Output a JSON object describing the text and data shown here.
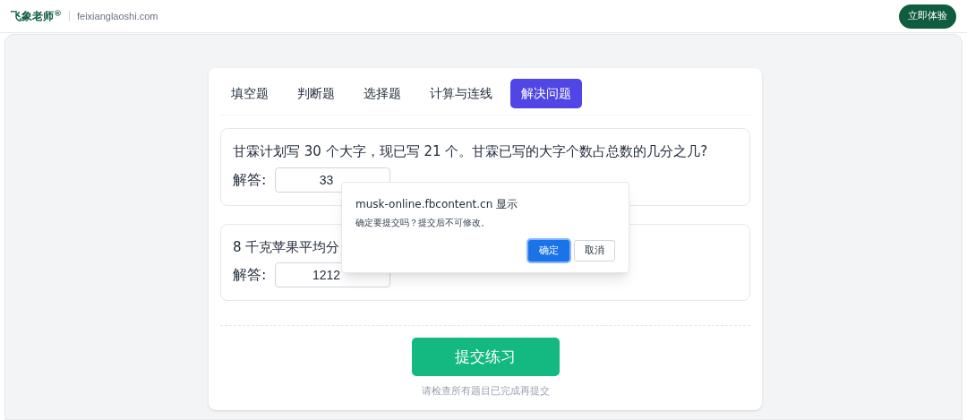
{
  "header": {
    "logo": "飞象老师$^{®}$",
    "domain": "feixianglaoshi.com",
    "cta": "立即体验"
  },
  "tabs": [
    {
      "label": "填空题",
      "selected": false
    },
    {
      "label": "判断题",
      "selected": false
    },
    {
      "label": "选择题",
      "selected": false
    },
    {
      "label": "计算与连线",
      "selected": false
    },
    {
      "label": "解决问题",
      "selected": true
    }
  ],
  "questions": [
    {
      "text": "甘霖计划写 30 个大字，现已写 21 个。甘霖已写的大字个数占总数的几分之几?",
      "answer_label": "解答:",
      "value": "33"
    },
    {
      "text": "8 千克苹果平均分",
      "answer_label": "解答:",
      "value": "1212"
    }
  ],
  "submit": {
    "label": "提交练习",
    "hint": "请检查所有题目已完成再提交"
  },
  "dialog": {
    "title": "musk-online.fbcontent.cn 显示",
    "message": "确定要提交吗？提交后不可修改。",
    "buttons": [
      {
        "label": "确定",
        "selected": true
      },
      {
        "label": "取消",
        "selected": false
      }
    ]
  }
}
